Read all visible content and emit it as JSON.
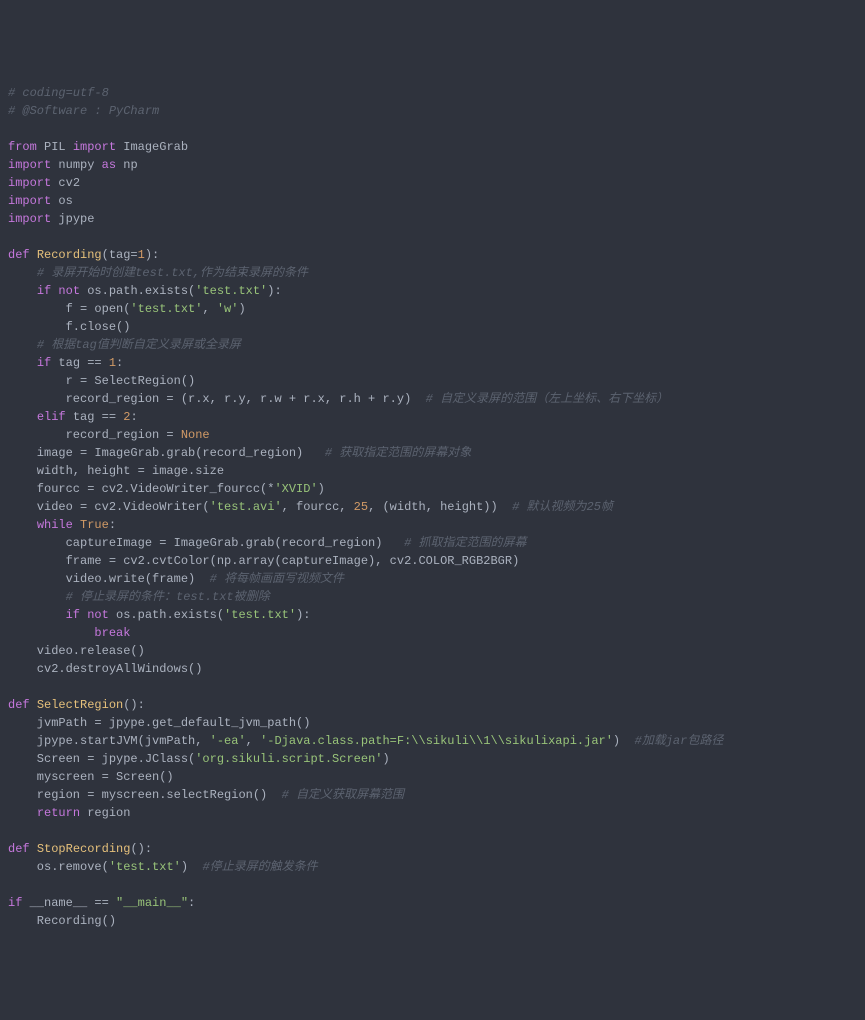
{
  "code": {
    "lines": [
      {
        "tokens": [
          {
            "cls": "c-comment",
            "t": "# coding=utf-8"
          }
        ]
      },
      {
        "tokens": [
          {
            "cls": "c-comment",
            "t": "# @Software : PyCharm"
          }
        ]
      },
      {
        "tokens": []
      },
      {
        "tokens": [
          {
            "cls": "c-keyword",
            "t": "from"
          },
          {
            "cls": "c-default",
            "t": " PIL "
          },
          {
            "cls": "c-keyword",
            "t": "import"
          },
          {
            "cls": "c-default",
            "t": " ImageGrab"
          }
        ]
      },
      {
        "tokens": [
          {
            "cls": "c-keyword",
            "t": "import"
          },
          {
            "cls": "c-default",
            "t": " numpy "
          },
          {
            "cls": "c-keyword",
            "t": "as"
          },
          {
            "cls": "c-default",
            "t": " np"
          }
        ]
      },
      {
        "tokens": [
          {
            "cls": "c-keyword",
            "t": "import"
          },
          {
            "cls": "c-default",
            "t": " cv2"
          }
        ]
      },
      {
        "tokens": [
          {
            "cls": "c-keyword",
            "t": "import"
          },
          {
            "cls": "c-default",
            "t": " os"
          }
        ]
      },
      {
        "tokens": [
          {
            "cls": "c-keyword",
            "t": "import"
          },
          {
            "cls": "c-default",
            "t": " jpype"
          }
        ]
      },
      {
        "tokens": []
      },
      {
        "tokens": [
          {
            "cls": "c-keyword",
            "t": "def"
          },
          {
            "cls": "c-default",
            "t": " "
          },
          {
            "cls": "c-funcname",
            "t": "Recording"
          },
          {
            "cls": "c-default",
            "t": "(tag="
          },
          {
            "cls": "c-number",
            "t": "1"
          },
          {
            "cls": "c-default",
            "t": "):"
          }
        ]
      },
      {
        "tokens": [
          {
            "cls": "c-default",
            "t": "    "
          },
          {
            "cls": "c-comment",
            "t": "# 录屏开始时创建test.txt,作为结束录屏的条件"
          }
        ]
      },
      {
        "tokens": [
          {
            "cls": "c-default",
            "t": "    "
          },
          {
            "cls": "c-keyword",
            "t": "if"
          },
          {
            "cls": "c-default",
            "t": " "
          },
          {
            "cls": "c-keyword",
            "t": "not"
          },
          {
            "cls": "c-default",
            "t": " os.path.exists("
          },
          {
            "cls": "c-string",
            "t": "'test.txt'"
          },
          {
            "cls": "c-default",
            "t": "):"
          }
        ]
      },
      {
        "tokens": [
          {
            "cls": "c-default",
            "t": "        f = open("
          },
          {
            "cls": "c-string",
            "t": "'test.txt'"
          },
          {
            "cls": "c-default",
            "t": ", "
          },
          {
            "cls": "c-string",
            "t": "'w'"
          },
          {
            "cls": "c-default",
            "t": ")"
          }
        ]
      },
      {
        "tokens": [
          {
            "cls": "c-default",
            "t": "        f.close()"
          }
        ]
      },
      {
        "tokens": [
          {
            "cls": "c-default",
            "t": "    "
          },
          {
            "cls": "c-comment",
            "t": "# 根据tag值判断自定义录屏或全录屏"
          }
        ]
      },
      {
        "tokens": [
          {
            "cls": "c-default",
            "t": "    "
          },
          {
            "cls": "c-keyword",
            "t": "if"
          },
          {
            "cls": "c-default",
            "t": " tag == "
          },
          {
            "cls": "c-number",
            "t": "1"
          },
          {
            "cls": "c-default",
            "t": ":"
          }
        ]
      },
      {
        "tokens": [
          {
            "cls": "c-default",
            "t": "        r = SelectRegion()"
          }
        ]
      },
      {
        "tokens": [
          {
            "cls": "c-default",
            "t": "        record_region = (r.x, r.y, r.w + r.x, r.h + r.y)  "
          },
          {
            "cls": "c-comment",
            "t": "# 自定义录屏的范围（左上坐标、右下坐标）"
          }
        ]
      },
      {
        "tokens": [
          {
            "cls": "c-default",
            "t": "    "
          },
          {
            "cls": "c-keyword",
            "t": "elif"
          },
          {
            "cls": "c-default",
            "t": " tag == "
          },
          {
            "cls": "c-number",
            "t": "2"
          },
          {
            "cls": "c-default",
            "t": ":"
          }
        ]
      },
      {
        "tokens": [
          {
            "cls": "c-default",
            "t": "        record_region = "
          },
          {
            "cls": "c-const",
            "t": "None"
          }
        ]
      },
      {
        "tokens": [
          {
            "cls": "c-default",
            "t": "    image = ImageGrab.grab(record_region)   "
          },
          {
            "cls": "c-comment",
            "t": "# 获取指定范围的屏幕对象"
          }
        ]
      },
      {
        "tokens": [
          {
            "cls": "c-default",
            "t": "    width, height = image.size"
          }
        ]
      },
      {
        "tokens": [
          {
            "cls": "c-default",
            "t": "    fourcc = cv2.VideoWriter_fourcc(*"
          },
          {
            "cls": "c-string",
            "t": "'XVID'"
          },
          {
            "cls": "c-default",
            "t": ")"
          }
        ]
      },
      {
        "tokens": [
          {
            "cls": "c-default",
            "t": "    video = cv2.VideoWriter("
          },
          {
            "cls": "c-string",
            "t": "'test.avi'"
          },
          {
            "cls": "c-default",
            "t": ", fourcc, "
          },
          {
            "cls": "c-number",
            "t": "25"
          },
          {
            "cls": "c-default",
            "t": ", (width, height))  "
          },
          {
            "cls": "c-comment",
            "t": "# 默认视频为25帧"
          }
        ]
      },
      {
        "tokens": [
          {
            "cls": "c-default",
            "t": "    "
          },
          {
            "cls": "c-keyword",
            "t": "while"
          },
          {
            "cls": "c-default",
            "t": " "
          },
          {
            "cls": "c-const",
            "t": "True"
          },
          {
            "cls": "c-default",
            "t": ":"
          }
        ]
      },
      {
        "tokens": [
          {
            "cls": "c-default",
            "t": "        captureImage = ImageGrab.grab(record_region)   "
          },
          {
            "cls": "c-comment",
            "t": "# 抓取指定范围的屏幕"
          }
        ]
      },
      {
        "tokens": [
          {
            "cls": "c-default",
            "t": "        frame = cv2.cvtColor(np.array(captureImage), cv2.COLOR_RGB2BGR)"
          }
        ]
      },
      {
        "tokens": [
          {
            "cls": "c-default",
            "t": "        video.write(frame)  "
          },
          {
            "cls": "c-comment",
            "t": "# 将每帧画面写视频文件"
          }
        ]
      },
      {
        "tokens": [
          {
            "cls": "c-default",
            "t": "        "
          },
          {
            "cls": "c-comment",
            "t": "# 停止录屏的条件：test.txt被删除"
          }
        ]
      },
      {
        "tokens": [
          {
            "cls": "c-default",
            "t": "        "
          },
          {
            "cls": "c-keyword",
            "t": "if"
          },
          {
            "cls": "c-default",
            "t": " "
          },
          {
            "cls": "c-keyword",
            "t": "not"
          },
          {
            "cls": "c-default",
            "t": " os.path.exists("
          },
          {
            "cls": "c-string",
            "t": "'test.txt'"
          },
          {
            "cls": "c-default",
            "t": "):"
          }
        ]
      },
      {
        "tokens": [
          {
            "cls": "c-default",
            "t": "            "
          },
          {
            "cls": "c-keyword",
            "t": "break"
          }
        ]
      },
      {
        "tokens": [
          {
            "cls": "c-default",
            "t": "    video.release()"
          }
        ]
      },
      {
        "tokens": [
          {
            "cls": "c-default",
            "t": "    cv2.destroyAllWindows()"
          }
        ]
      },
      {
        "tokens": []
      },
      {
        "tokens": [
          {
            "cls": "c-keyword",
            "t": "def"
          },
          {
            "cls": "c-default",
            "t": " "
          },
          {
            "cls": "c-funcname",
            "t": "SelectRegion"
          },
          {
            "cls": "c-default",
            "t": "():"
          }
        ]
      },
      {
        "tokens": [
          {
            "cls": "c-default",
            "t": "    jvmPath = jpype.get_default_jvm_path()"
          }
        ]
      },
      {
        "tokens": [
          {
            "cls": "c-default",
            "t": "    jpype.startJVM(jvmPath, "
          },
          {
            "cls": "c-string",
            "t": "'-ea'"
          },
          {
            "cls": "c-default",
            "t": ", "
          },
          {
            "cls": "c-string",
            "t": "'-Djava.class.path=F:\\\\sikuli\\\\1\\\\sikulixapi.jar'"
          },
          {
            "cls": "c-default",
            "t": ")  "
          },
          {
            "cls": "c-comment",
            "t": "#加载jar包路径"
          }
        ]
      },
      {
        "tokens": [
          {
            "cls": "c-default",
            "t": "    Screen = jpype.JClass("
          },
          {
            "cls": "c-string",
            "t": "'org.sikuli.script.Screen'"
          },
          {
            "cls": "c-default",
            "t": ")"
          }
        ]
      },
      {
        "tokens": [
          {
            "cls": "c-default",
            "t": "    myscreen = Screen()"
          }
        ]
      },
      {
        "tokens": [
          {
            "cls": "c-default",
            "t": "    region = myscreen.selectRegion()  "
          },
          {
            "cls": "c-comment",
            "t": "# 自定义获取屏幕范围"
          }
        ]
      },
      {
        "tokens": [
          {
            "cls": "c-default",
            "t": "    "
          },
          {
            "cls": "c-keyword",
            "t": "return"
          },
          {
            "cls": "c-default",
            "t": " region"
          }
        ]
      },
      {
        "tokens": []
      },
      {
        "tokens": [
          {
            "cls": "c-keyword",
            "t": "def"
          },
          {
            "cls": "c-default",
            "t": " "
          },
          {
            "cls": "c-funcname",
            "t": "StopRecording"
          },
          {
            "cls": "c-default",
            "t": "():"
          }
        ]
      },
      {
        "tokens": [
          {
            "cls": "c-default",
            "t": "    os.remove("
          },
          {
            "cls": "c-string",
            "t": "'test.txt'"
          },
          {
            "cls": "c-default",
            "t": ")  "
          },
          {
            "cls": "c-comment",
            "t": "#停止录屏的触发条件"
          }
        ]
      },
      {
        "tokens": []
      },
      {
        "tokens": [
          {
            "cls": "c-keyword",
            "t": "if"
          },
          {
            "cls": "c-default",
            "t": " __name__ == "
          },
          {
            "cls": "c-string",
            "t": "\"__main__\""
          },
          {
            "cls": "c-default",
            "t": ":"
          }
        ]
      },
      {
        "tokens": [
          {
            "cls": "c-default",
            "t": "    Recording()"
          }
        ]
      }
    ]
  }
}
